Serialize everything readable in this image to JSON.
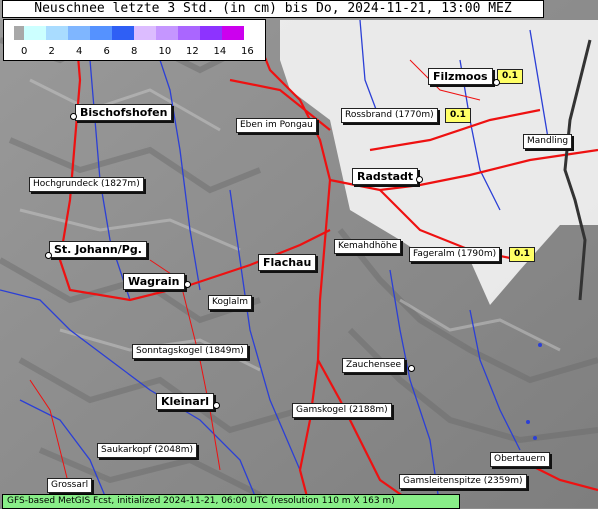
{
  "title": "Neuschnee letzte 3 Std. (in cm) bis Do, 2024-11-21, 13:00 MEZ",
  "legend": {
    "colors": [
      "#a8a8a8",
      "#ccffff",
      "#a9dcff",
      "#7fb6ff",
      "#5592ff",
      "#2f5ff5",
      "#dcbcff",
      "#c596ff",
      "#aa66ff",
      "#8d33ff",
      "#cc00ee"
    ],
    "ticks": [
      "0",
      "2",
      "4",
      "6",
      "8",
      "10",
      "12",
      "14",
      "16"
    ]
  },
  "places": [
    {
      "id": "filzmoos",
      "name": "Filzmoos",
      "big": true,
      "value": "0.1"
    },
    {
      "id": "rossbrand",
      "name": "Rossbrand (1770m)",
      "value": "0.1"
    },
    {
      "id": "bischofshofen",
      "name": "Bischofshofen",
      "big": true
    },
    {
      "id": "eben",
      "name": "Eben im Pongau"
    },
    {
      "id": "mandling",
      "name": "Mandling"
    },
    {
      "id": "hochgrundeck",
      "name": "Hochgrundeck (1827m)"
    },
    {
      "id": "radstadt",
      "name": "Radstadt",
      "big": true
    },
    {
      "id": "kemahdhoehe",
      "name": "Kemahdhöhe"
    },
    {
      "id": "fageralm",
      "name": "Fageralm (1790m)",
      "value": "0.1"
    },
    {
      "id": "stjohann",
      "name": "St. Johann/Pg.",
      "big": true
    },
    {
      "id": "flachau",
      "name": "Flachau",
      "big": true
    },
    {
      "id": "wagrain",
      "name": "Wagrain",
      "big": true
    },
    {
      "id": "koglalm",
      "name": "Koglalm"
    },
    {
      "id": "sonntagskogel",
      "name": "Sonntagskogel (1849m)"
    },
    {
      "id": "zauchensee",
      "name": "Zauchensee"
    },
    {
      "id": "kleinarl",
      "name": "Kleinarl",
      "big": true
    },
    {
      "id": "gamskogel",
      "name": "Gamskogel (2188m)"
    },
    {
      "id": "saukarkopf",
      "name": "Saukarkopf (2048m)"
    },
    {
      "id": "obertauern",
      "name": "Obertauern"
    },
    {
      "id": "grossarl",
      "name": "Grossarl"
    },
    {
      "id": "gamsleitenspitze",
      "name": "Gamsleitenspitze (2359m)"
    }
  ],
  "footer": "GFS-based MetGIS Fcst, initialized 2024-11-21, 06:00 UTC  (resolution 110 m X 163 m)"
}
